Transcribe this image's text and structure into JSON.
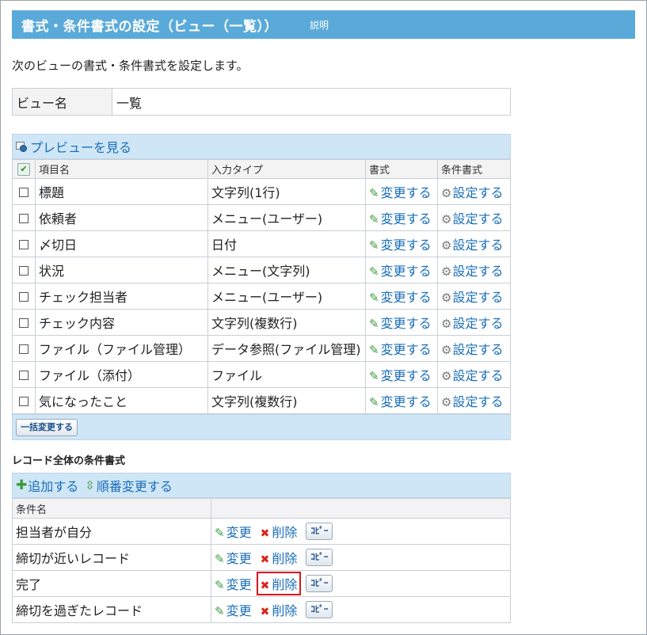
{
  "header": {
    "title": "書式・条件書式の設定（ビュー（一覧））",
    "help_link": "説明"
  },
  "description": "次のビューの書式・条件書式を設定します。",
  "view": {
    "name_label": "ビュー名",
    "name_value": "一覧"
  },
  "fields": {
    "preview_link": "プレビューを見る",
    "columns": {
      "item_name": "項目名",
      "input_type": "入力タイプ",
      "format": "書式",
      "conditional_format": "条件書式"
    },
    "rows": [
      {
        "name": "標題",
        "type": "文字列(1行)"
      },
      {
        "name": "依頼者",
        "type": "メニュー(ユーザー)"
      },
      {
        "name": "〆切日",
        "type": "日付"
      },
      {
        "name": "状況",
        "type": "メニュー(文字列)"
      },
      {
        "name": "チェック担当者",
        "type": "メニュー(ユーザー)"
      },
      {
        "name": "チェック内容",
        "type": "文字列(複数行)"
      },
      {
        "name": "ファイル（ファイル管理）",
        "type": "データ参照(ファイル管理)"
      },
      {
        "name": "ファイル（添付）",
        "type": "ファイル"
      },
      {
        "name": "気になったこと",
        "type": "文字列(複数行)"
      }
    ],
    "change_label": "変更する",
    "set_label": "設定する",
    "bulk_change_button": "一括変更する"
  },
  "record_conditions": {
    "heading": "レコード全体の条件書式",
    "add_link": "追加する",
    "reorder_link": "順番変更する",
    "column_name": "条件名",
    "rows": [
      {
        "name": "担当者が自分"
      },
      {
        "name": "締切が近いレコード"
      },
      {
        "name": "完了",
        "highlighted": true
      },
      {
        "name": "締切を過ぎたレコード"
      }
    ],
    "edit_label": "変更",
    "delete_label": "削除",
    "copy_label": "ｺﾋﾟｰ"
  },
  "colors": {
    "title_bar": "#5aaad9",
    "link": "#1a6eb8",
    "highlight_box": "#e0141e",
    "toolbar": "#cfe6f6"
  },
  "icons": {
    "preview": "preview-magnifier-icon",
    "edit": "pencil-icon",
    "settings": "gear-icon",
    "add": "plus-icon",
    "reorder": "updown-arrows-icon",
    "delete": "cross-icon"
  }
}
